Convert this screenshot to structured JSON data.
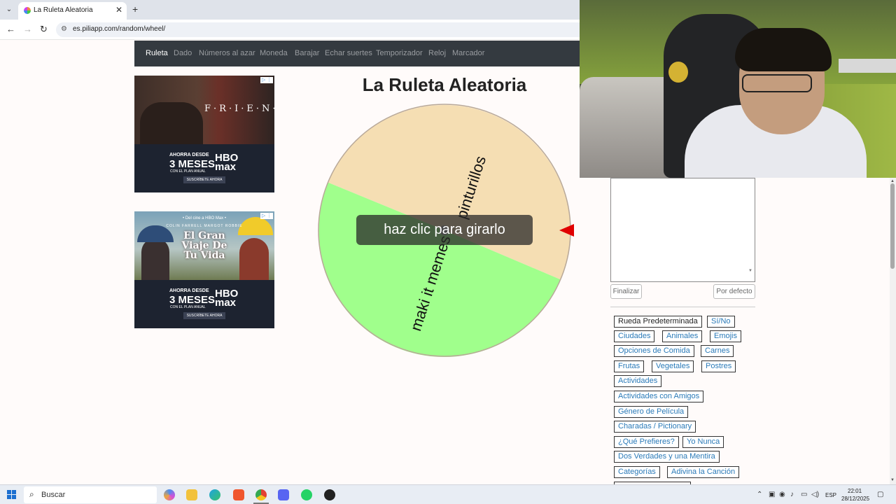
{
  "browser": {
    "tab_title": "La Ruleta Aleatoria",
    "tab_close": "✕",
    "new_tab": "+",
    "url": "es.piliapp.com/random/wheel/"
  },
  "nav": {
    "items": [
      "Ruleta",
      "Dado",
      "Números al azar",
      "Moneda",
      "Barajar",
      "Echar suertes",
      "Temporizador",
      "Reloj",
      "Marcador"
    ],
    "active_index": 0
  },
  "ads": {
    "ad1": {
      "brand": "F·R·I·E·N·D·S",
      "promo_line1": "AHORRA DESDE",
      "promo_line2": "3 MESES",
      "promo_line3": "CON EL PLAN ANUAL",
      "hbo": "HBO max",
      "cta": "SUSCRÍBETE AHORA"
    },
    "ad2": {
      "pre": "• Del cine a HBO Max •",
      "names": "COLIN FARRELL     MARGOT ROBBIE",
      "title": "El Gran Viaje De Tu Vida",
      "promo_line1": "AHORRA DESDE",
      "promo_line2": "3 MESES",
      "promo_line3": "CON EL PLAN ANUAL",
      "hbo": "HBO max",
      "cta": "SUSCRÍBETE AHORA"
    }
  },
  "page": {
    "title": "La Ruleta Aleatoria",
    "spin_label": "haz clic para girarlo"
  },
  "wheel": {
    "segments": [
      {
        "label": "pinturillos",
        "color": "#f5deb3"
      },
      {
        "label": "maki it memes",
        "color": "#a0ff8c"
      }
    ],
    "pointer_color": "#e00000"
  },
  "controls": {
    "finish_label": "Finalizar",
    "default_label": "Por defecto"
  },
  "presets": [
    "Rueda Predeterminada",
    "Sí/No",
    "Ciudades",
    "Animales",
    "Emojis",
    "Opciones de Comida",
    "Carnes",
    "Frutas",
    "Vegetales",
    "Postres",
    "Actividades",
    "Actividades con Amigos",
    "Género de Película",
    "Charadas / Pictionary",
    "¿Qué Prefieres?",
    "Yo Nunca",
    "Dos Verdades y una Mentira",
    "Categorías",
    "Adivina la Canción"
  ],
  "taskbar": {
    "search_placeholder": "Buscar",
    "lang": "ESP",
    "time": "22:01",
    "date": "28/12/2025"
  }
}
